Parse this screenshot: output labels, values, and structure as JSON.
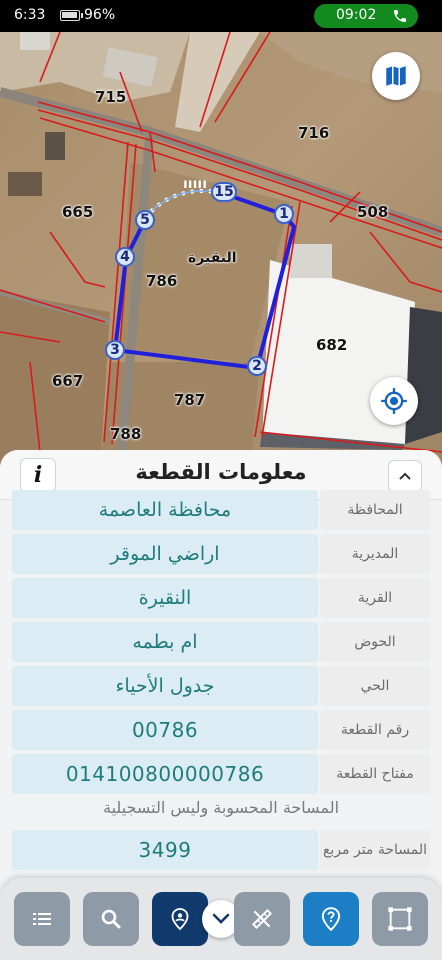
{
  "status_bar": {
    "time": "6:33",
    "battery": "96%",
    "call_time": "09:02",
    "call_icon": "phone-icon"
  },
  "map": {
    "parcel_labels": {
      "p715": "715",
      "p716": "716",
      "p665": "665",
      "p508": "508",
      "p786": "786",
      "p682": "682",
      "p667": "667",
      "p787": "787",
      "p788": "788"
    },
    "village_label": "النقيرة",
    "vertices": [
      "1",
      "2",
      "3",
      "4",
      "5",
      "15"
    ],
    "arc_marks": "ווווו",
    "colors": {
      "parcel_outline": "#1f1fdc",
      "boundary_lines": "#d81b1b",
      "map_button": "#1565c0"
    },
    "buttons": {
      "layers_icon": "map-layers-icon",
      "locate_icon": "locate-icon"
    }
  },
  "panel": {
    "title": "معلومات القطعة",
    "info_label": "i",
    "rows": [
      {
        "label": "المحافظة",
        "value": "محافظة العاصمة"
      },
      {
        "label": "المديرية",
        "value": "اراضي الموقر"
      },
      {
        "label": "القرية",
        "value": "النقيرة"
      },
      {
        "label": "الحوض",
        "value": "ام بطمه"
      },
      {
        "label": "الحي",
        "value": "جدول الأحياء"
      },
      {
        "label": "رقم القطعة",
        "value": "00786"
      },
      {
        "label": "مفتاح القطعة",
        "value": "014100800000786"
      }
    ],
    "note": "المساحة المحسوبة وليس التسجيلية",
    "area_row": {
      "label": "المساحة متر مربع",
      "value": "3499"
    }
  },
  "toolbar": {
    "buttons": [
      "list-icon",
      "search-icon",
      "location-pin-icon",
      "chevron-down-icon",
      "measure-tool-icon",
      "help-icon",
      "polygon-icon"
    ],
    "colors": {
      "grey": "#8e9aa6",
      "navy": "#0f3a6b",
      "blue": "#1c7fc6"
    }
  }
}
